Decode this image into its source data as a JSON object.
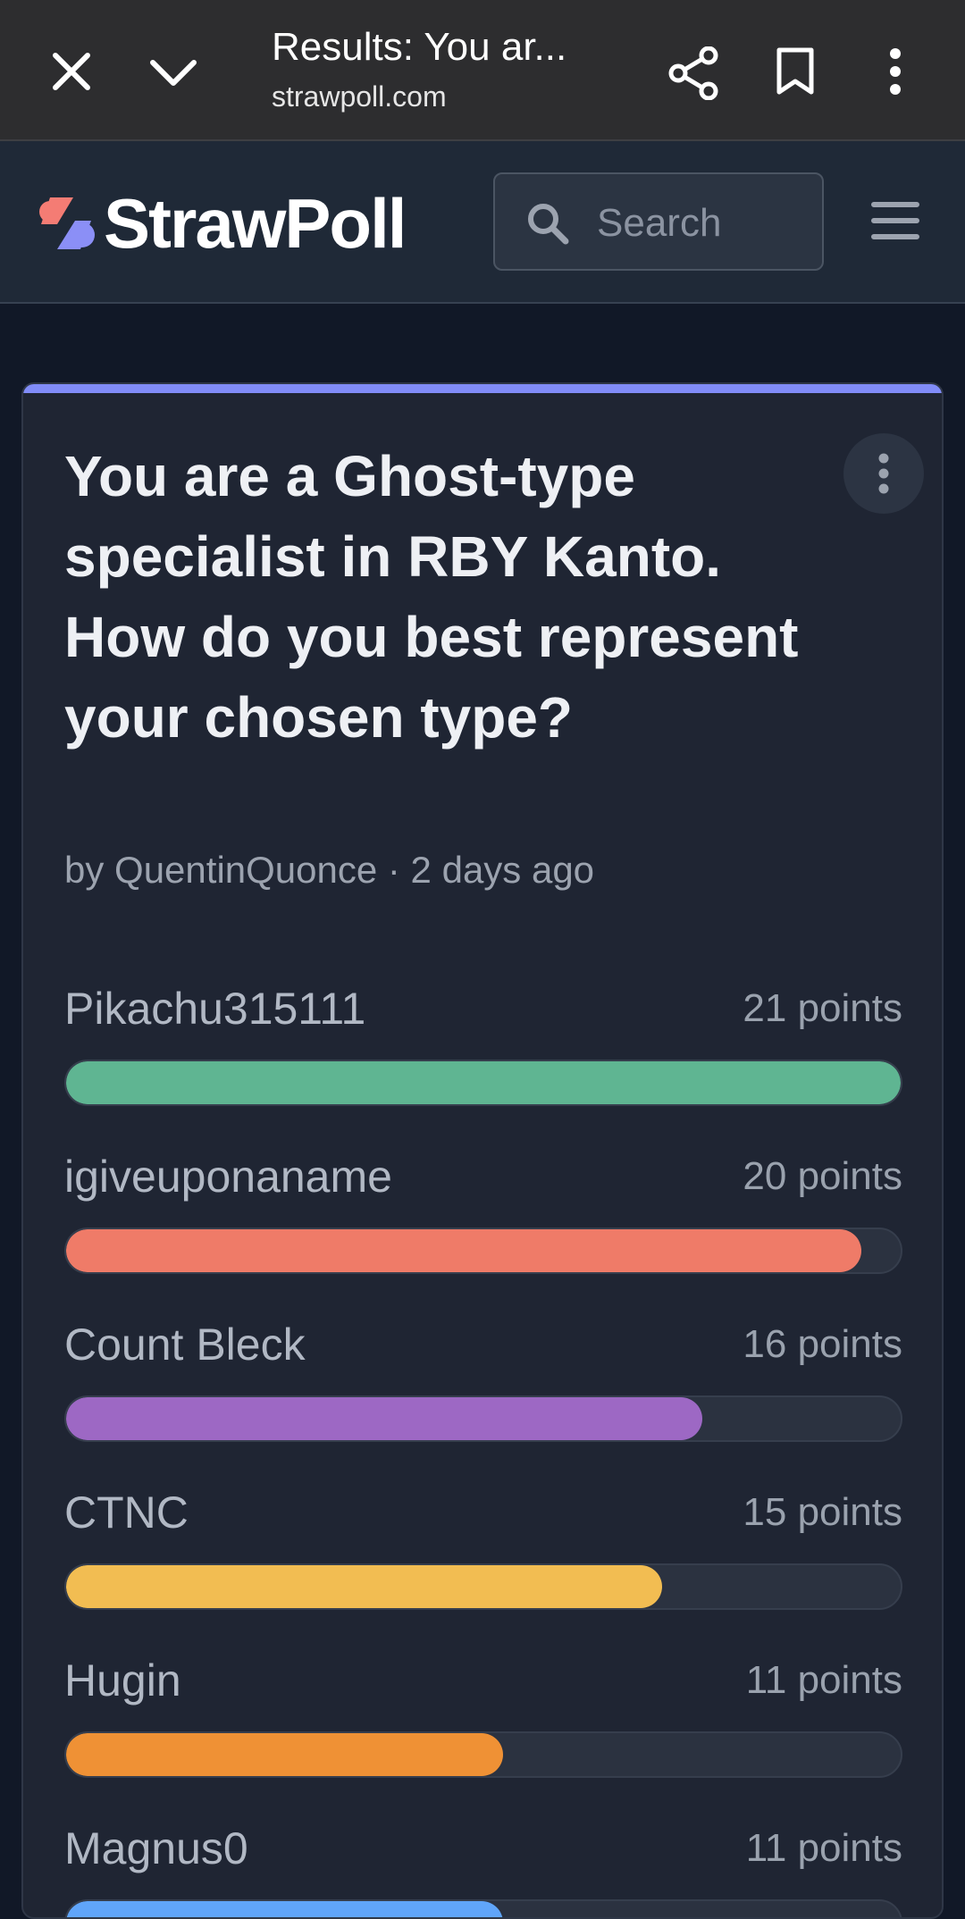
{
  "browser": {
    "title": "Results: You ar...",
    "url": "strawpoll.com",
    "icons": [
      "close-icon",
      "chevron-down-icon",
      "share-icon",
      "bookmark-icon",
      "more-vertical-icon"
    ]
  },
  "header": {
    "logo_text": "StrawPoll",
    "search_placeholder": "Search",
    "icons": [
      "search-icon",
      "menu-icon"
    ]
  },
  "poll": {
    "title": "You are a Ghost-type specialist in RBY Kanto. How do you best represent your chosen type?",
    "meta": "by QuentinQuonce · 2 days ago",
    "accent_color": "#818cf8",
    "max_points": 21,
    "options": [
      {
        "name": "Pikachu315111",
        "points_label": "21 points",
        "points": 21,
        "color": "#5fb592"
      },
      {
        "name": "igiveuponaname",
        "points_label": "20 points",
        "points": 20,
        "color": "#ef7b68"
      },
      {
        "name": "Count Bleck",
        "points_label": "16 points",
        "points": 16,
        "color": "#9d68c4"
      },
      {
        "name": "CTNC",
        "points_label": "15 points",
        "points": 15,
        "color": "#f2bd52"
      },
      {
        "name": "Hugin",
        "points_label": "11 points",
        "points": 11,
        "color": "#ef9135"
      },
      {
        "name": "Magnus0",
        "points_label": "11 points",
        "points": 11,
        "color": "#60a5fa"
      }
    ]
  }
}
